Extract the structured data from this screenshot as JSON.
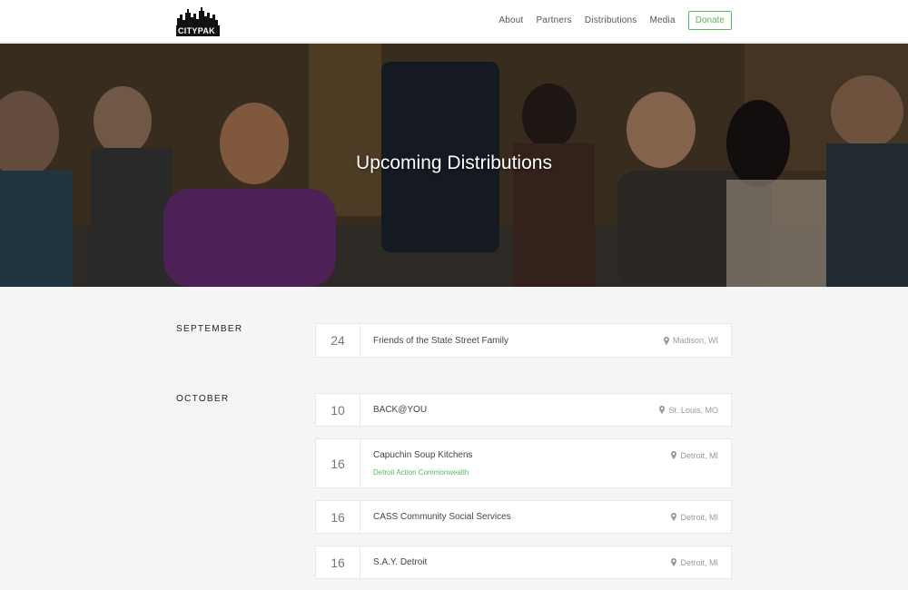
{
  "brand": {
    "logo_text": "CITYPAK"
  },
  "nav": {
    "links": [
      "About",
      "Partners",
      "Distributions",
      "Media"
    ],
    "donate_label": "Donate"
  },
  "hero": {
    "title": "Upcoming Distributions"
  },
  "colors": {
    "accent": "#5cb85c",
    "card_bg": "#ffffff",
    "page_bg": "#f5f5f5"
  },
  "icons": {
    "location": "map-pin-icon"
  },
  "months": [
    {
      "name": "SEPTEMBER",
      "events": [
        {
          "day": "24",
          "name": "Friends of the State Street Family",
          "partner": "",
          "location": "Madison, WI"
        }
      ]
    },
    {
      "name": "OCTOBER",
      "events": [
        {
          "day": "10",
          "name": "BACK@YOU",
          "partner": "",
          "location": "St. Louis, MO"
        },
        {
          "day": "16",
          "name": "Capuchin Soup Kitchens",
          "partner": "Detroit Action Commonwealth",
          "location": "Detroit, MI"
        },
        {
          "day": "16",
          "name": "CASS Community Social Services",
          "partner": "",
          "location": "Detroit, MI"
        },
        {
          "day": "16",
          "name": "S.A.Y. Detroit",
          "partner": "",
          "location": "Detroit, MI"
        }
      ]
    }
  ]
}
